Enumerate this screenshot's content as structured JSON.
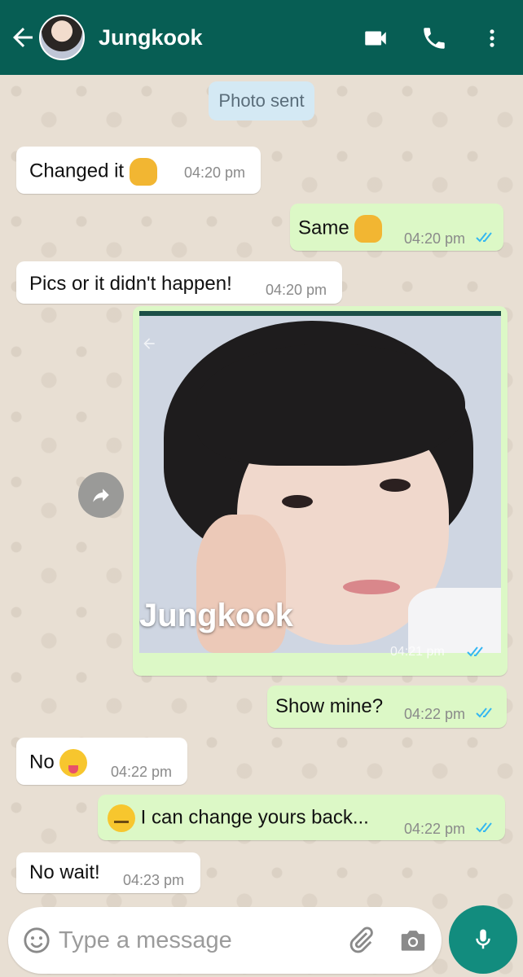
{
  "header": {
    "contact_name": "Jungkook",
    "icons": [
      "back-arrow-icon",
      "video-call-icon",
      "phone-icon",
      "more-vert-icon"
    ]
  },
  "chat": {
    "date_chip": "Photo sent",
    "messages": [
      {
        "direction": "in",
        "text": "Changed it",
        "emoji": "thumbs-up",
        "time": "04:20 pm"
      },
      {
        "direction": "out",
        "text": "Same",
        "emoji": "thumbs-up",
        "time": "04:20 pm",
        "read": true
      },
      {
        "direction": "in",
        "text": "Pics or it didn't happen!",
        "time": "04:20 pm"
      },
      {
        "direction": "out",
        "type": "photo",
        "caption": "Jungkook",
        "time": "04:21 pm",
        "read": true
      },
      {
        "direction": "out",
        "text": "Show mine?",
        "time": "04:22 pm",
        "read": true
      },
      {
        "direction": "in",
        "text": "No",
        "emoji": "tongue-out",
        "time": "04:22 pm"
      },
      {
        "direction": "out",
        "text": "I can change yours back...",
        "emoji": "expressionless",
        "time": "04:22 pm",
        "read": true
      },
      {
        "direction": "in",
        "text": "No wait!",
        "time": "04:23 pm"
      }
    ]
  },
  "composer": {
    "placeholder": "Type a message",
    "icons": [
      "emoji-icon",
      "paperclip-icon",
      "camera-icon",
      "microphone-icon"
    ]
  },
  "colors": {
    "header": "#075e54",
    "outgoing_bubble": "#dcf8c6",
    "incoming_bubble": "#ffffff",
    "read_ticks": "#34b7f1",
    "mic_button": "#128c7e"
  }
}
